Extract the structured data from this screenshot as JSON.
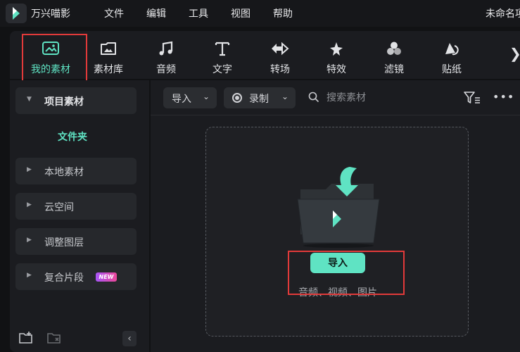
{
  "app": {
    "name": "万兴喵影",
    "document_title": "未命名项"
  },
  "menu": [
    "文件",
    "编辑",
    "工具",
    "视图",
    "帮助"
  ],
  "toolbar": {
    "tools": [
      {
        "label": "我的素材",
        "icon": "media-icon",
        "active": true
      },
      {
        "label": "素材库",
        "icon": "stock-library-icon",
        "active": false
      },
      {
        "label": "音频",
        "icon": "music-note-icon",
        "active": false
      },
      {
        "label": "文字",
        "icon": "text-icon",
        "active": false
      },
      {
        "label": "转场",
        "icon": "transition-icon",
        "active": false
      },
      {
        "label": "特效",
        "icon": "effects-star-icon",
        "active": false
      },
      {
        "label": "滤镜",
        "icon": "filter-circles-icon",
        "active": false
      },
      {
        "label": "贴纸",
        "icon": "sticker-icon",
        "active": false
      }
    ],
    "more_glyph": "❯"
  },
  "sidebar": {
    "project_media": "项目素材",
    "folder": "文件夹",
    "items": [
      {
        "label": "本地素材"
      },
      {
        "label": "云空间"
      },
      {
        "label": "调整图层"
      },
      {
        "label": "复合片段",
        "badge": "NEW"
      }
    ],
    "collapse_glyph": "‹"
  },
  "main": {
    "import_dropdown": "导入",
    "record_dropdown": "录制",
    "search_placeholder": "搜索素材",
    "dropzone": {
      "import_button": "导入",
      "types": "音频、视频、图片"
    }
  },
  "colors": {
    "accent": "#5fe3c3",
    "annotation": "#e23a3a",
    "background": "#1b1c20"
  }
}
